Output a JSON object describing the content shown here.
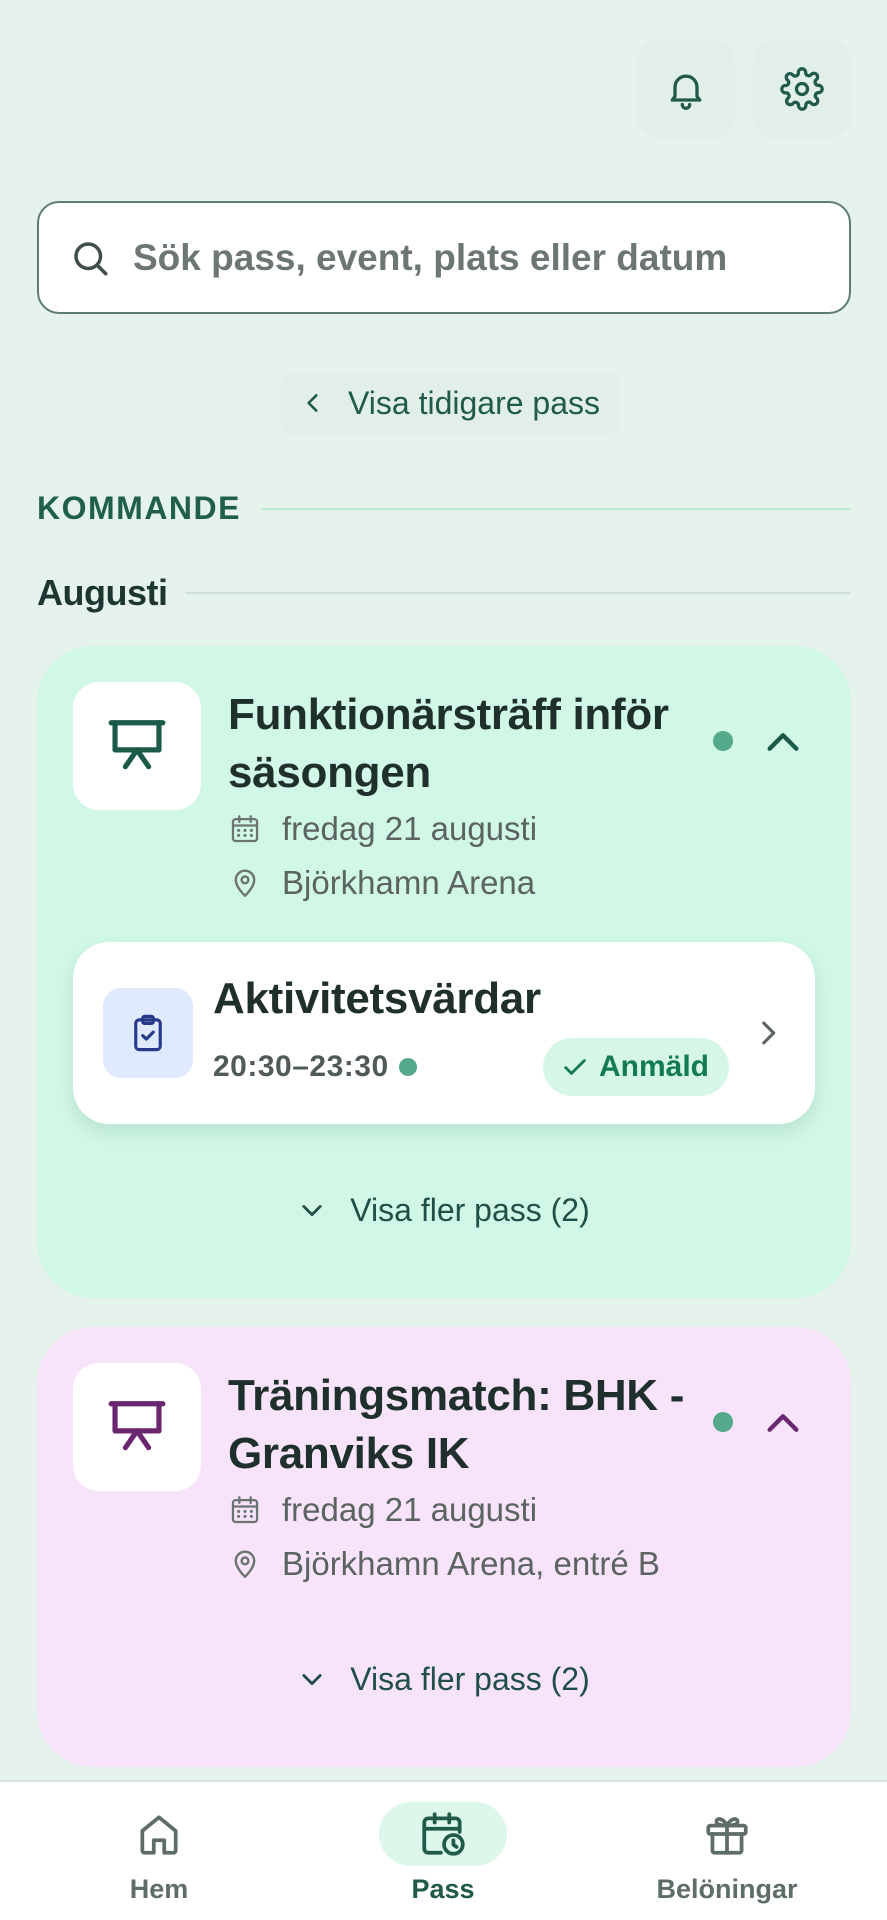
{
  "search": {
    "placeholder": "Sök pass, event, plats eller datum"
  },
  "earlier_button": {
    "label": "Visa tidigare pass"
  },
  "section": {
    "label": "KOMMANDE"
  },
  "month": {
    "label": "Augusti"
  },
  "events": [
    {
      "title": "Funktionärsträff inför säsongen",
      "date": "fredag 21 augusti",
      "location": "Björkhamn Arena",
      "icon_color": "#1b5a48",
      "card_color": "#d1f8e6",
      "sessions": [
        {
          "title": "Aktivitetsvärdar",
          "time": "20:30–23:30",
          "status": "Anmäld"
        }
      ],
      "more_label": "Visa fler pass (2)"
    },
    {
      "title": "Träningsmatch: BHK - Granviks IK",
      "date": "fredag 21 augusti",
      "location": "Björkhamn Arena, entré B",
      "icon_color": "#6b2670",
      "card_color": "#f8e4fa",
      "sessions": [],
      "more_label": "Visa fler pass (2)"
    }
  ],
  "nav": {
    "items": [
      {
        "label": "Hem",
        "icon": "home-icon",
        "active": false
      },
      {
        "label": "Pass",
        "icon": "calendar-clock-icon",
        "active": true
      },
      {
        "label": "Belöningar",
        "icon": "gift-icon",
        "active": false
      }
    ]
  },
  "icons": {
    "bell": "bell-icon",
    "settings": "gear-icon"
  }
}
